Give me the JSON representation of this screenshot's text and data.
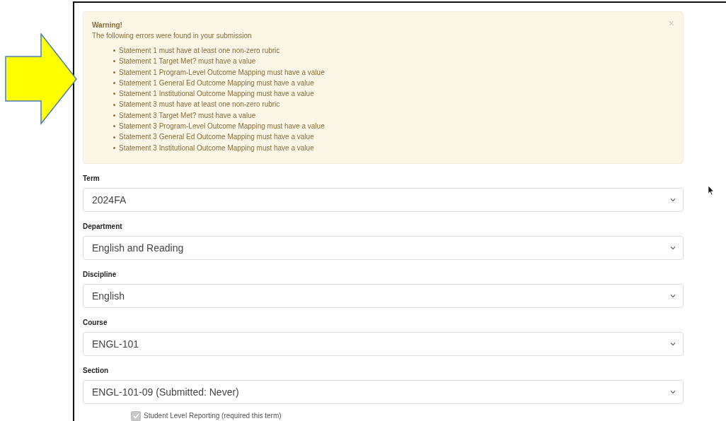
{
  "alert": {
    "title": "Warning!",
    "message": "The following errors were found in your submission",
    "close": "×",
    "errors": [
      "Statement 1 must have at least one non-zero rubric",
      "Statement 1 Target Met? must have a value",
      "Statement 1 Program-Level Outcome Mapping must have a value",
      "Statement 1 General Ed Outcome Mapping must have a value",
      "Statement 1 Institutional Outcome Mapping must have a value",
      "Statement 3 must have at least one non-zero rubric",
      "Statement 3 Target Met? must have a value",
      "Statement 3 Program-Level Outcome Mapping must have a value",
      "Statement 3 General Ed Outcome Mapping must have a value",
      "Statement 3 Institutional Outcome Mapping must have a value"
    ]
  },
  "fields": [
    {
      "label": "Term",
      "value": "2024FA"
    },
    {
      "label": "Department",
      "value": "English and Reading"
    },
    {
      "label": "Discipline",
      "value": "English"
    },
    {
      "label": "Course",
      "value": "ENGL-101"
    },
    {
      "label": "Section",
      "value": "ENGL-101-09 (Submitted: Never)"
    }
  ],
  "checkbox": {
    "label": "Student Level Reporting (required this term)",
    "checked": true,
    "disabled": true
  }
}
